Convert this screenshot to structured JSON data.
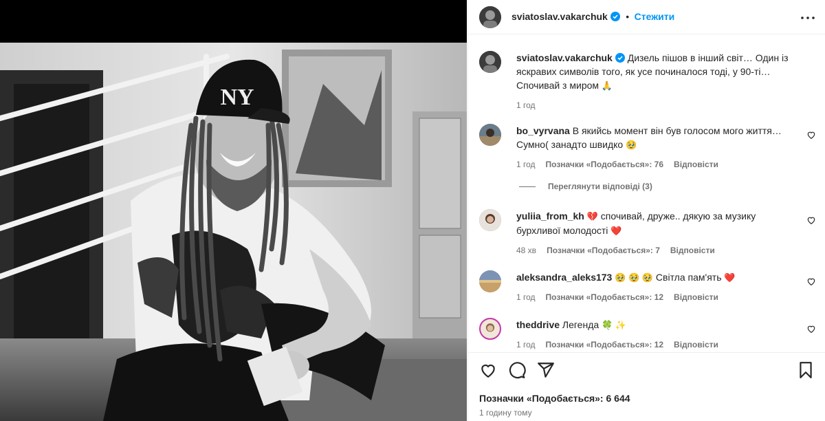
{
  "post": {
    "author": "sviatoslav.vakarchuk",
    "follow_label": "Стежити",
    "separator": "•",
    "caption": "Дизель пішов в інший світ… Один із яскравих символів того, як усе починалося тоді, у 90-ті… Спочивай з миром",
    "caption_emoji": "🙏",
    "caption_time": "1 год"
  },
  "comments": [
    {
      "user": "bo_vyrvana",
      "text": "В якийсь момент він був голосом мого життя… Сумно( занадто швидко",
      "emoji": "🥹",
      "time": "1 год",
      "likes": "Позначки «Подобається»: 76",
      "reply": "Відповісти"
    },
    {
      "user": "yuliia_from_kh",
      "lead_emoji": "💔",
      "text": "спочивай, друже.. дякую за музику бурхливої молодості",
      "emoji": "❤️",
      "time": "48 хв",
      "likes": "Позначки «Подобається»: 7",
      "reply": "Відповісти"
    },
    {
      "user": "aleksandra_aleks173",
      "lead_emoji": "🥹 🥹 🥹",
      "text": "Світла пам'ять",
      "emoji": "❤️",
      "time": "1 год",
      "likes": "Позначки «Подобається»: 12",
      "reply": "Відповісти"
    },
    {
      "user": "theddrive",
      "text": "Легенда",
      "emoji": "🍀 ✨",
      "time": "1 год",
      "likes": "Позначки «Подобається»: 12",
      "reply": "Відповісти"
    }
  ],
  "view_replies": "Переглянути відповіді (3)",
  "footer": {
    "likes": "Позначки «Подобається»: 6 644",
    "ago": "1 годину тому"
  },
  "colors": {
    "accent": "#0095f6",
    "verified": "#0095f6",
    "muted": "#737373",
    "text": "#262626",
    "heart": "#ed4956"
  },
  "icons": [
    "more-icon",
    "verified-icon",
    "heart-icon",
    "comment-icon",
    "share-icon",
    "bookmark-icon"
  ]
}
